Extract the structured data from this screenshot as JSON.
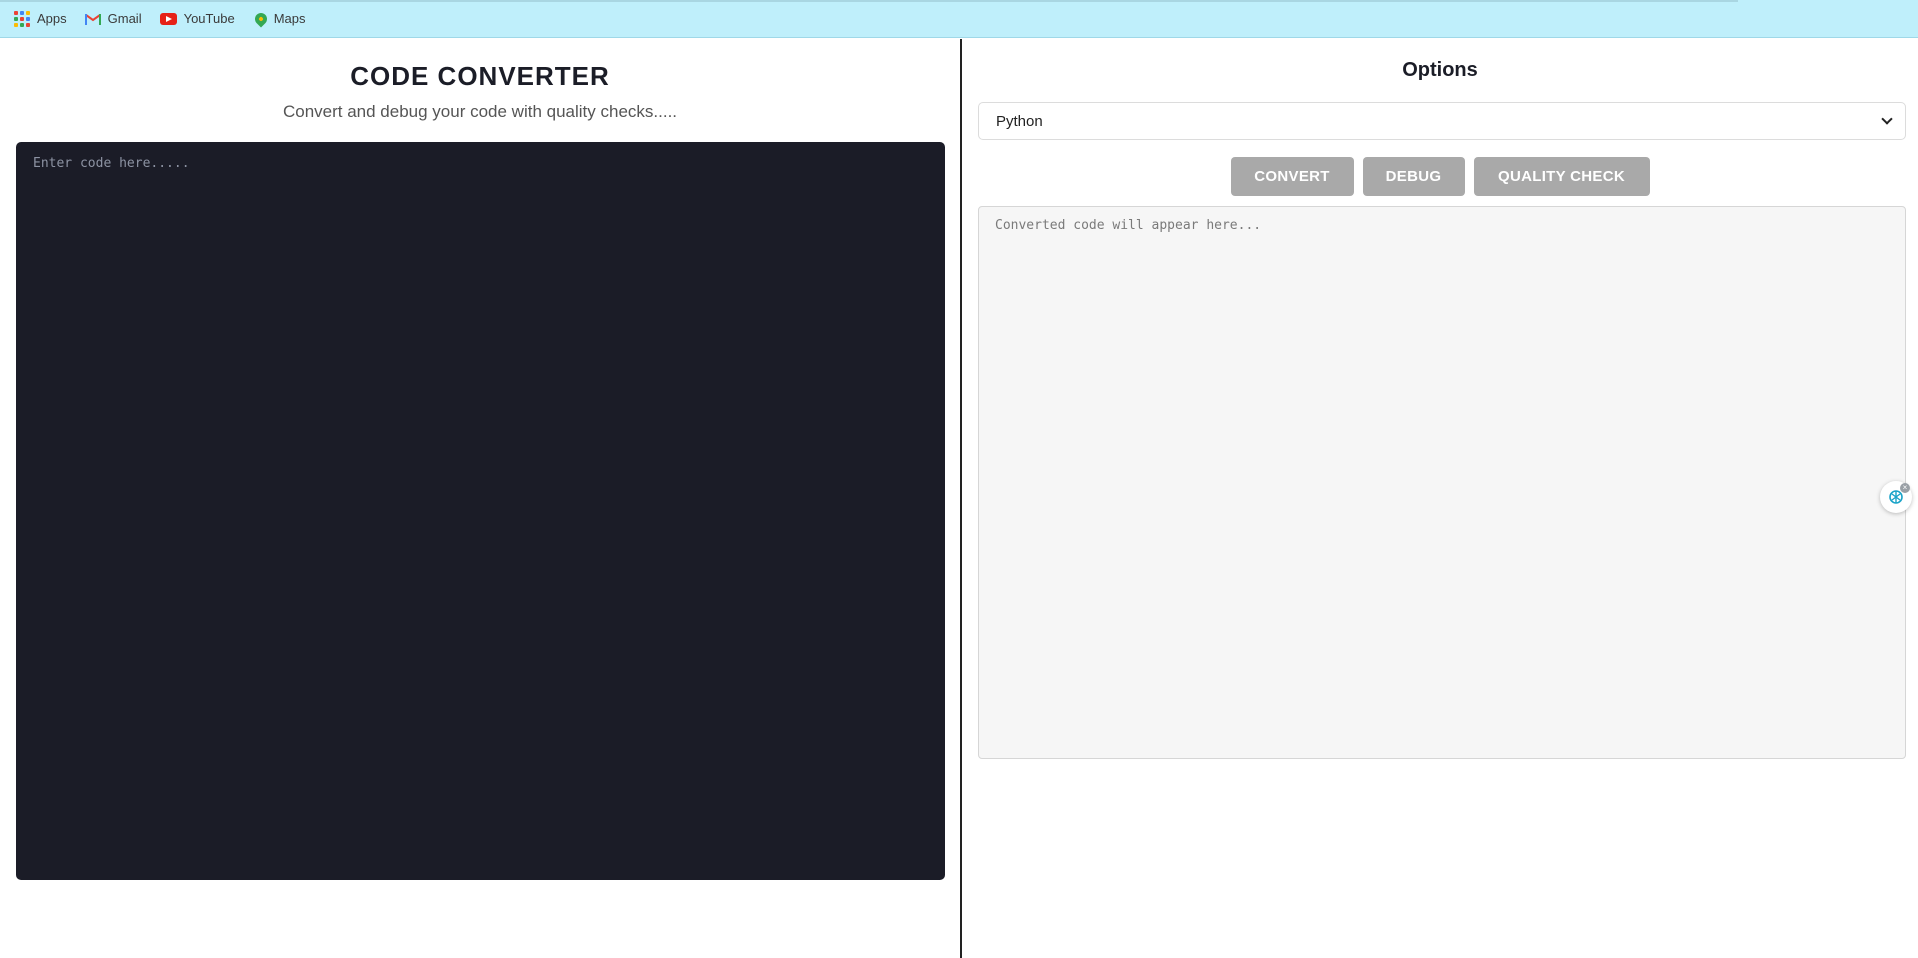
{
  "bookmarks": [
    {
      "label": "Apps",
      "icon": "apps-grid-icon"
    },
    {
      "label": "Gmail",
      "icon": "gmail-icon"
    },
    {
      "label": "YouTube",
      "icon": "youtube-icon"
    },
    {
      "label": "Maps",
      "icon": "maps-icon"
    }
  ],
  "left": {
    "title": "CODE CONVERTER",
    "subtitle": "Convert and debug your code with quality checks.....",
    "code_placeholder": "Enter code here....."
  },
  "right": {
    "options_title": "Options",
    "selected_language": "Python",
    "buttons": {
      "convert": "CONVERT",
      "debug": "DEBUG",
      "quality_check": "QUALITY CHECK"
    },
    "output_placeholder": "Converted code will appear here..."
  },
  "colors": {
    "bookmarks_bg": "#bfeffb",
    "editor_bg": "#1b1c27",
    "button_bg": "#a9a9a9",
    "output_bg": "#f6f6f6"
  }
}
